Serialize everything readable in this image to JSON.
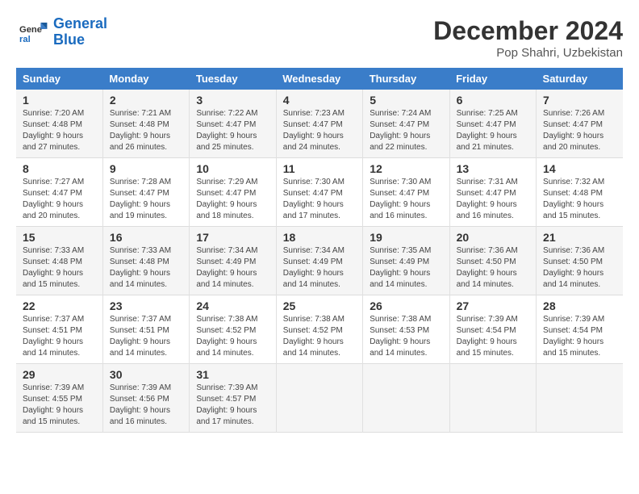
{
  "header": {
    "logo_line1": "General",
    "logo_line2": "Blue",
    "title": "December 2024",
    "subtitle": "Pop Shahri, Uzbekistan"
  },
  "calendar": {
    "days_of_week": [
      "Sunday",
      "Monday",
      "Tuesday",
      "Wednesday",
      "Thursday",
      "Friday",
      "Saturday"
    ],
    "weeks": [
      [
        {
          "day": "1",
          "sunrise": "7:20 AM",
          "sunset": "4:48 PM",
          "daylight": "9 hours and 27 minutes."
        },
        {
          "day": "2",
          "sunrise": "7:21 AM",
          "sunset": "4:48 PM",
          "daylight": "9 hours and 26 minutes."
        },
        {
          "day": "3",
          "sunrise": "7:22 AM",
          "sunset": "4:47 PM",
          "daylight": "9 hours and 25 minutes."
        },
        {
          "day": "4",
          "sunrise": "7:23 AM",
          "sunset": "4:47 PM",
          "daylight": "9 hours and 24 minutes."
        },
        {
          "day": "5",
          "sunrise": "7:24 AM",
          "sunset": "4:47 PM",
          "daylight": "9 hours and 22 minutes."
        },
        {
          "day": "6",
          "sunrise": "7:25 AM",
          "sunset": "4:47 PM",
          "daylight": "9 hours and 21 minutes."
        },
        {
          "day": "7",
          "sunrise": "7:26 AM",
          "sunset": "4:47 PM",
          "daylight": "9 hours and 20 minutes."
        }
      ],
      [
        {
          "day": "8",
          "sunrise": "7:27 AM",
          "sunset": "4:47 PM",
          "daylight": "9 hours and 20 minutes."
        },
        {
          "day": "9",
          "sunrise": "7:28 AM",
          "sunset": "4:47 PM",
          "daylight": "9 hours and 19 minutes."
        },
        {
          "day": "10",
          "sunrise": "7:29 AM",
          "sunset": "4:47 PM",
          "daylight": "9 hours and 18 minutes."
        },
        {
          "day": "11",
          "sunrise": "7:30 AM",
          "sunset": "4:47 PM",
          "daylight": "9 hours and 17 minutes."
        },
        {
          "day": "12",
          "sunrise": "7:30 AM",
          "sunset": "4:47 PM",
          "daylight": "9 hours and 16 minutes."
        },
        {
          "day": "13",
          "sunrise": "7:31 AM",
          "sunset": "4:47 PM",
          "daylight": "9 hours and 16 minutes."
        },
        {
          "day": "14",
          "sunrise": "7:32 AM",
          "sunset": "4:48 PM",
          "daylight": "9 hours and 15 minutes."
        }
      ],
      [
        {
          "day": "15",
          "sunrise": "7:33 AM",
          "sunset": "4:48 PM",
          "daylight": "9 hours and 15 minutes."
        },
        {
          "day": "16",
          "sunrise": "7:33 AM",
          "sunset": "4:48 PM",
          "daylight": "9 hours and 14 minutes."
        },
        {
          "day": "17",
          "sunrise": "7:34 AM",
          "sunset": "4:49 PM",
          "daylight": "9 hours and 14 minutes."
        },
        {
          "day": "18",
          "sunrise": "7:34 AM",
          "sunset": "4:49 PM",
          "daylight": "9 hours and 14 minutes."
        },
        {
          "day": "19",
          "sunrise": "7:35 AM",
          "sunset": "4:49 PM",
          "daylight": "9 hours and 14 minutes."
        },
        {
          "day": "20",
          "sunrise": "7:36 AM",
          "sunset": "4:50 PM",
          "daylight": "9 hours and 14 minutes."
        },
        {
          "day": "21",
          "sunrise": "7:36 AM",
          "sunset": "4:50 PM",
          "daylight": "9 hours and 14 minutes."
        }
      ],
      [
        {
          "day": "22",
          "sunrise": "7:37 AM",
          "sunset": "4:51 PM",
          "daylight": "9 hours and 14 minutes."
        },
        {
          "day": "23",
          "sunrise": "7:37 AM",
          "sunset": "4:51 PM",
          "daylight": "9 hours and 14 minutes."
        },
        {
          "day": "24",
          "sunrise": "7:38 AM",
          "sunset": "4:52 PM",
          "daylight": "9 hours and 14 minutes."
        },
        {
          "day": "25",
          "sunrise": "7:38 AM",
          "sunset": "4:52 PM",
          "daylight": "9 hours and 14 minutes."
        },
        {
          "day": "26",
          "sunrise": "7:38 AM",
          "sunset": "4:53 PM",
          "daylight": "9 hours and 14 minutes."
        },
        {
          "day": "27",
          "sunrise": "7:39 AM",
          "sunset": "4:54 PM",
          "daylight": "9 hours and 15 minutes."
        },
        {
          "day": "28",
          "sunrise": "7:39 AM",
          "sunset": "4:54 PM",
          "daylight": "9 hours and 15 minutes."
        }
      ],
      [
        {
          "day": "29",
          "sunrise": "7:39 AM",
          "sunset": "4:55 PM",
          "daylight": "9 hours and 15 minutes."
        },
        {
          "day": "30",
          "sunrise": "7:39 AM",
          "sunset": "4:56 PM",
          "daylight": "9 hours and 16 minutes."
        },
        {
          "day": "31",
          "sunrise": "7:39 AM",
          "sunset": "4:57 PM",
          "daylight": "9 hours and 17 minutes."
        },
        null,
        null,
        null,
        null
      ]
    ]
  }
}
